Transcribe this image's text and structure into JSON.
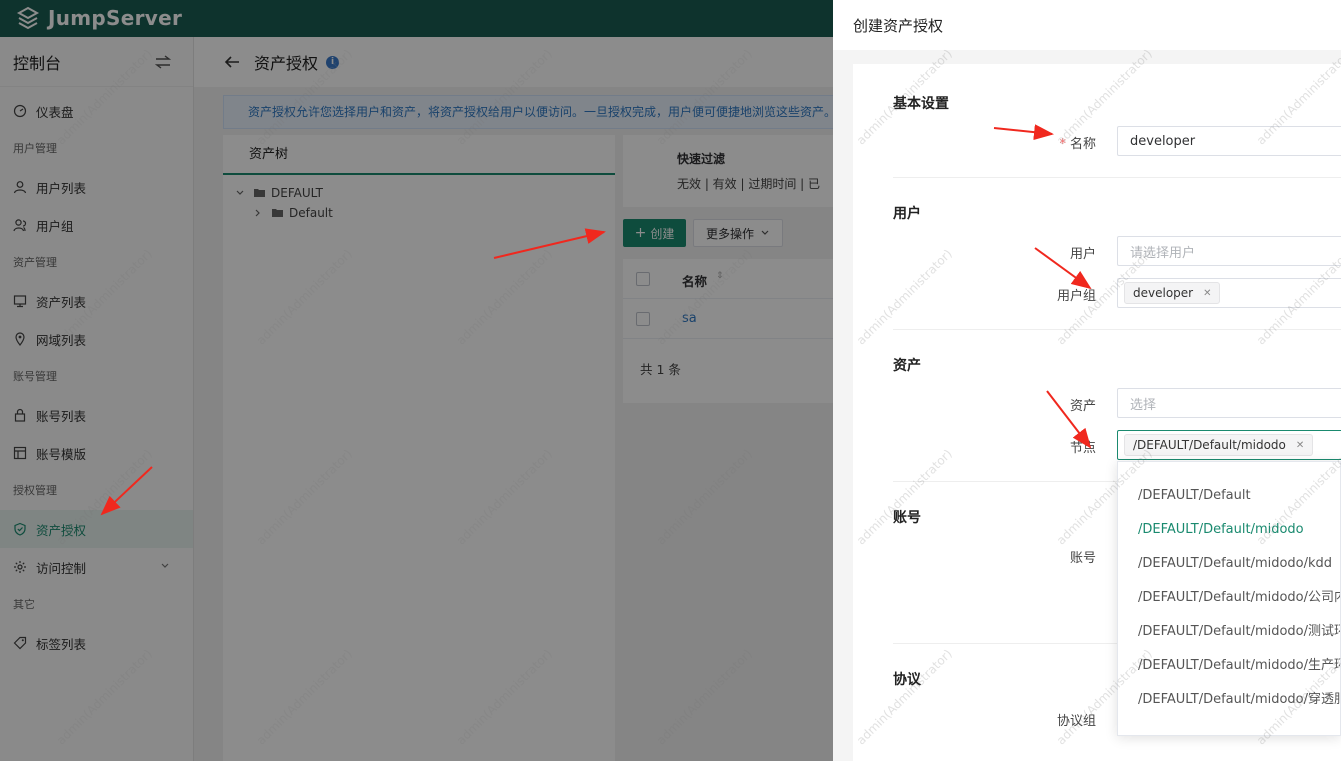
{
  "brand": {
    "name": "JumpServer"
  },
  "sidebar": {
    "title": "控制台",
    "items": [
      {
        "type": "item",
        "label": "仪表盘",
        "icon": "dashboard-icon"
      },
      {
        "type": "group",
        "label": "用户管理"
      },
      {
        "type": "item",
        "label": "用户列表",
        "icon": "user-icon"
      },
      {
        "type": "item",
        "label": "用户组",
        "icon": "user-group-icon"
      },
      {
        "type": "group",
        "label": "资产管理"
      },
      {
        "type": "item",
        "label": "资产列表",
        "icon": "monitor-icon"
      },
      {
        "type": "item",
        "label": "网域列表",
        "icon": "location-icon"
      },
      {
        "type": "group",
        "label": "账号管理"
      },
      {
        "type": "item",
        "label": "账号列表",
        "icon": "lock-icon"
      },
      {
        "type": "item",
        "label": "账号模版",
        "icon": "template-icon"
      },
      {
        "type": "group",
        "label": "授权管理"
      },
      {
        "type": "item",
        "label": "资产授权",
        "icon": "shield-icon",
        "active": true
      },
      {
        "type": "item",
        "label": "访问控制",
        "icon": "settings-icon",
        "expandable": true
      },
      {
        "type": "group",
        "label": "其它"
      },
      {
        "type": "item",
        "label": "标签列表",
        "icon": "tag-icon"
      }
    ]
  },
  "page": {
    "title": "资产授权",
    "info_badge": "i",
    "banner": "资产授权允许您选择用户和资产，将资产授权给用户以便访问。一旦授权完成，用户便可便捷地浏览这些资产。",
    "tree": {
      "title": "资产树",
      "nodes": [
        "DEFAULT",
        "Default"
      ]
    },
    "filter": {
      "title": "快速过滤",
      "options": "无效 | 有效 | 过期时间 | 已"
    },
    "actions": {
      "create": "创建",
      "more": "更多操作"
    },
    "table": {
      "header_name": "名称",
      "rows": [
        "sa"
      ],
      "footer": "共 1 条"
    }
  },
  "drawer": {
    "title": "创建资产授权",
    "sections": {
      "basic": "基本设置",
      "user": "用户",
      "asset": "资产",
      "account": "账号",
      "protocol": "协议"
    },
    "fields": {
      "name_label": "名称",
      "name_value": "developer",
      "user_label": "用户",
      "user_placeholder": "请选择用户",
      "usergroup_label": "用户组",
      "usergroup_tag": "developer",
      "asset_label": "资产",
      "asset_placeholder": "选择",
      "node_label": "节点",
      "node_tag": "/DEFAULT/Default/midodo",
      "account_label": "账号",
      "protocol_label": "协议组"
    },
    "node_options": [
      {
        "label": "/DEFAULT",
        "selected": false
      },
      {
        "label": "/DEFAULT/Default",
        "selected": false
      },
      {
        "label": "/DEFAULT/Default/midodo",
        "selected": true
      },
      {
        "label": "/DEFAULT/Default/midodo/kdd",
        "selected": false
      },
      {
        "label": "/DEFAULT/Default/midodo/公司内",
        "selected": false
      },
      {
        "label": "/DEFAULT/Default/midodo/测试环",
        "selected": false
      },
      {
        "label": "/DEFAULT/Default/midodo/生产环",
        "selected": false
      },
      {
        "label": "/DEFAULT/Default/midodo/穿透服",
        "selected": false
      }
    ]
  },
  "watermark": "admin(Administrator)",
  "colors": {
    "brand": "#1a5e52",
    "accent": "#1a8a6f",
    "arrow": "#f0281e"
  }
}
